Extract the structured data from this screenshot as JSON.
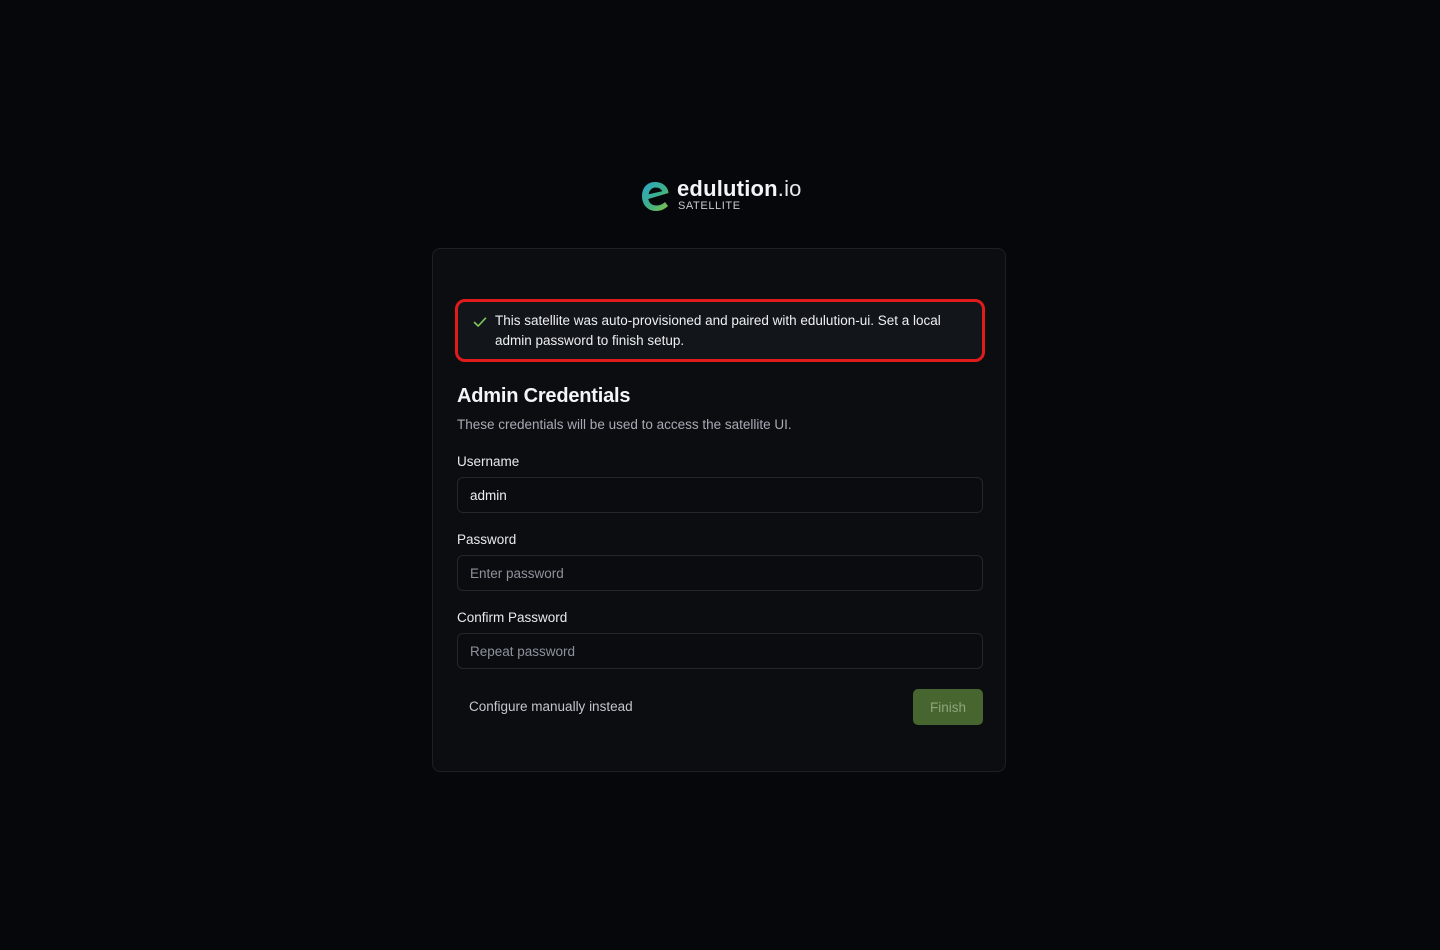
{
  "brand": {
    "name": "edulution",
    "tld": ".io",
    "subtitle": "SATELLITE"
  },
  "alert": {
    "icon": "check-icon",
    "message": "This satellite was auto-provisioned and paired with edulution-ui. Set a local admin password to finish setup."
  },
  "form": {
    "title": "Admin Credentials",
    "description": "These credentials will be used to access the satellite UI.",
    "username": {
      "label": "Username",
      "value": "admin"
    },
    "password": {
      "label": "Password",
      "placeholder": "Enter password"
    },
    "confirm_password": {
      "label": "Confirm Password",
      "placeholder": "Repeat password"
    },
    "manual_link": "Configure manually instead",
    "finish_label": "Finish"
  },
  "colors": {
    "background": "#05070b",
    "card": "#0b0d11",
    "alert_border": "#e01b1b",
    "check": "#7ec85a",
    "finish_button": "#46652f"
  }
}
